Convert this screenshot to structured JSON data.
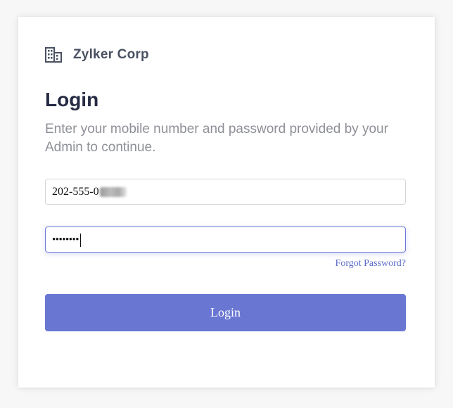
{
  "brand": {
    "icon": "building-icon",
    "name": "Zylker Corp"
  },
  "login": {
    "title": "Login",
    "subtitle": "Enter your mobile number and password provided by your Admin to continue.",
    "mobile": {
      "value": "202-555-0"
    },
    "password": {
      "masked_value": "••••••••"
    },
    "forgot_password_label": "Forgot Password?",
    "submit_label": "Login"
  },
  "colors": {
    "accent": "#6977d3",
    "link": "#5b6ac9",
    "title": "#262b44",
    "subtitle": "#8e9097"
  }
}
